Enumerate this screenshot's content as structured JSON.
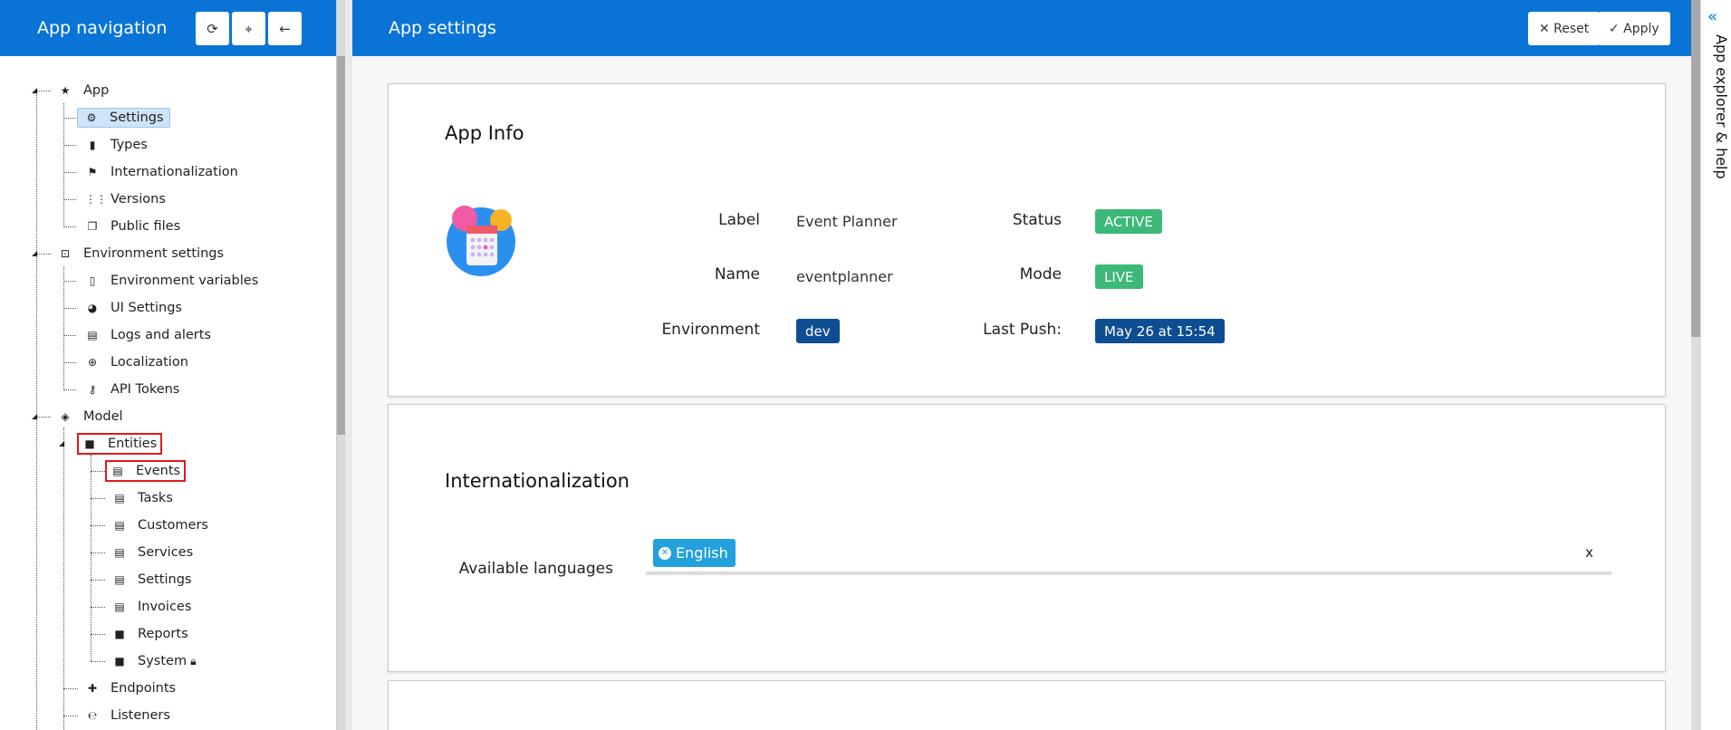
{
  "nav": {
    "title": "App navigation",
    "tools": [
      {
        "icon": "refresh-icon",
        "glyph": "⟳"
      },
      {
        "icon": "locate-icon",
        "glyph": "⌖"
      },
      {
        "icon": "arrow-left-icon",
        "glyph": "←"
      }
    ],
    "tree": {
      "app": "App",
      "settings": "Settings",
      "types": "Types",
      "internationalization": "Internationalization",
      "versions": "Versions",
      "public_files": "Public files",
      "environment_settings": "Environment settings",
      "environment_variables": "Environment variables",
      "ui_settings": "UI Settings",
      "logs_and_alerts": "Logs and alerts",
      "localization": "Localization",
      "api_tokens": "API Tokens",
      "model": "Model",
      "entities": "Entities",
      "events": "Events",
      "tasks": "Tasks",
      "customers": "Customers",
      "services": "Services",
      "settings2": "Settings",
      "invoices": "Invoices",
      "reports": "Reports",
      "system": "System",
      "endpoints": "Endpoints",
      "listeners": "Listeners"
    }
  },
  "main": {
    "title": "App settings",
    "reset_label": "✕ Reset",
    "apply_label": "✓ Apply",
    "app_info": {
      "title": "App Info",
      "label_key": "Label",
      "label_value": "Event Planner",
      "name_key": "Name",
      "name_value": "eventplanner",
      "environment_key": "Environment",
      "environment_value": "dev",
      "status_key": "Status",
      "status_value": "ACTIVE",
      "mode_key": "Mode",
      "mode_value": "LIVE",
      "last_push_key": "Last Push:",
      "last_push_value": "May 26 at 15:54"
    },
    "i18n": {
      "title": "Internationalization",
      "available_languages_label": "Available languages",
      "languages": [
        "English"
      ],
      "clear_label": "x"
    }
  },
  "side": {
    "label": "App explorer & help",
    "chevron": "«"
  },
  "colors": {
    "header_blue": "#0a74d6",
    "status_green": "#3cb878",
    "env_blue": "#0d4d92",
    "chip_blue": "#22a1de",
    "highlight_red": "#e01919"
  }
}
